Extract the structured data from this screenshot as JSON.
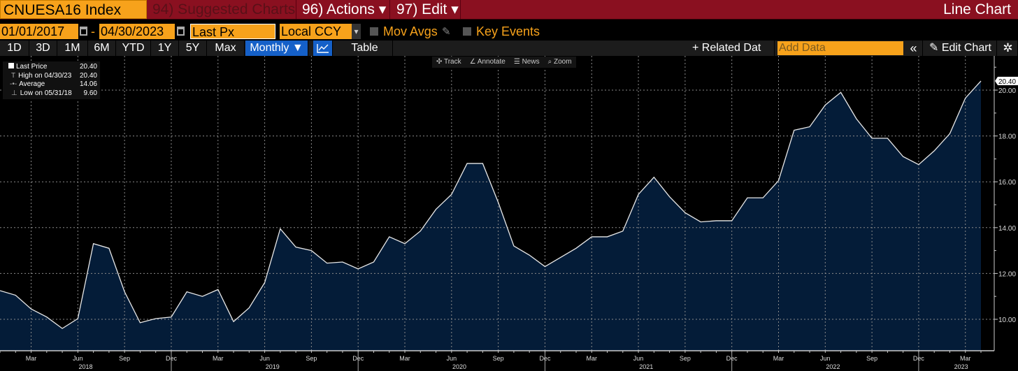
{
  "header": {
    "ticker": "CNUESA16 Index",
    "suggested": "94) Suggested Charts",
    "actions": "96) Actions ▾",
    "edit": "97) Edit ▾",
    "view_title": "Line Chart"
  },
  "controls": {
    "start_date": "01/01/2017",
    "dash": "-",
    "end_date": "04/30/2023",
    "field": "Last Px",
    "currency": "Local CCY",
    "currency_arrow": "▾",
    "mov_avgs": "Mov Avgs",
    "key_events": "Key Events"
  },
  "periods": [
    "1D",
    "3D",
    "1M",
    "6M",
    "YTD",
    "1Y",
    "5Y",
    "Max"
  ],
  "frequency": "Monthly ▼",
  "table_label": "Table",
  "related_data": "+ Related Dat",
  "add_data_placeholder": "Add Data",
  "collapse": "«",
  "edit_chart": "✎ Edit Chart",
  "settings": "✲",
  "chart_tools": [
    "✣ Track",
    "∠ Annotate",
    "☰ News",
    "⌕ Zoom"
  ],
  "legend": [
    {
      "label": "Last Price",
      "value": "20.40"
    },
    {
      "label": "High on 04/30/23",
      "value": "20.40"
    },
    {
      "label": "Average",
      "value": "14.06"
    },
    {
      "label": "Low on 05/31/18",
      "value": "9.60"
    }
  ],
  "chart_data": {
    "type": "area",
    "title": "CNUESA16 Index",
    "series_name": "Last Price",
    "start": "2018-01",
    "frequency": "monthly",
    "values": [
      11.25,
      11.05,
      10.45,
      10.1,
      9.6,
      10.03,
      13.3,
      13.1,
      11.2,
      9.85,
      10.03,
      10.1,
      11.2,
      11.0,
      11.3,
      9.9,
      10.5,
      11.6,
      13.95,
      13.15,
      13.0,
      12.45,
      12.5,
      12.2,
      12.5,
      13.6,
      13.3,
      13.85,
      14.8,
      15.45,
      16.8,
      16.8,
      15.1,
      13.2,
      12.8,
      12.3,
      12.7,
      13.1,
      13.6,
      13.6,
      13.85,
      15.45,
      16.2,
      15.35,
      14.65,
      14.25,
      14.3,
      14.3,
      15.3,
      15.3,
      16.05,
      18.25,
      18.4,
      19.35,
      19.9,
      18.75,
      17.9,
      17.9,
      17.1,
      16.75,
      17.35,
      18.1,
      19.65,
      20.4
    ],
    "last_value_label": "20.40",
    "ylim": [
      8.8,
      21.5
    ],
    "yticks": [
      "10.00",
      "12.00",
      "14.00",
      "16.00",
      "18.00",
      "20.00"
    ],
    "month_labels": [
      "Mar",
      "Jun",
      "Sep",
      "Dec"
    ],
    "years": [
      "2018",
      "2019",
      "2020",
      "2021",
      "2022",
      "2023"
    ],
    "grid": true,
    "colors": {
      "fill": "#041c38",
      "line": "#e8e8e8",
      "grid": "#8a8a8a"
    }
  }
}
